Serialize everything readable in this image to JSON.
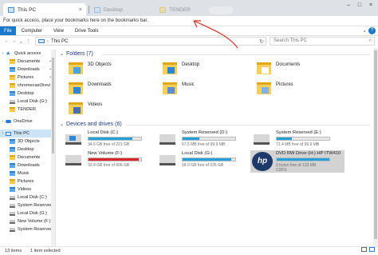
{
  "browser": {
    "tabs": [
      {
        "label": "This PC",
        "close": "×"
      },
      {
        "label": "Desktop"
      },
      {
        "label": "TENDER"
      }
    ],
    "window_controls": [
      "–",
      "□",
      "×"
    ]
  },
  "bookmarks_bar": {
    "hint": "For quick access, place your bookmarks here on the bookmarks bar."
  },
  "ribbon": {
    "tabs": [
      "File",
      "Computer",
      "View",
      "Drive Tools"
    ],
    "help": "?"
  },
  "address": {
    "path": "This PC",
    "search_placeholder": "Search This PC"
  },
  "sidebar": {
    "items": [
      {
        "label": "Quick access",
        "icon": "star-icon",
        "level": 0
      },
      {
        "label": "Documents",
        "icon": "folder-icon",
        "level": 1,
        "pinned": true
      },
      {
        "label": "Downloads",
        "icon": "downloads-icon",
        "level": 1,
        "pinned": true
      },
      {
        "label": "Pictures",
        "icon": "folder-icon",
        "level": 1,
        "pinned": true
      },
      {
        "label": "chromecast3revi",
        "icon": "folder-icon",
        "level": 1
      },
      {
        "label": "Desktop",
        "icon": "folder-blue-icon",
        "level": 1
      },
      {
        "label": "Local Disk (G:)",
        "icon": "drive-icon",
        "level": 1
      },
      {
        "label": "TENDER",
        "icon": "folder-icon",
        "level": 1
      },
      {
        "label": "",
        "icon": "",
        "level": 0
      },
      {
        "label": "OneDrive",
        "icon": "cloud-icon",
        "level": 0
      },
      {
        "label": "",
        "icon": "",
        "level": 0
      },
      {
        "label": "This PC",
        "icon": "pc-icon",
        "level": 0,
        "selected": true
      },
      {
        "label": "3D Objects",
        "icon": "folder-blue-icon",
        "level": 1
      },
      {
        "label": "Desktop",
        "icon": "folder-blue-icon",
        "level": 1
      },
      {
        "label": "Documents",
        "icon": "folder-icon",
        "level": 1
      },
      {
        "label": "Downloads",
        "icon": "downloads-icon",
        "level": 1
      },
      {
        "label": "Music",
        "icon": "music-icon",
        "level": 1
      },
      {
        "label": "Pictures",
        "icon": "folder-icon",
        "level": 1
      },
      {
        "label": "Videos",
        "icon": "videos-icon",
        "level": 1
      },
      {
        "label": "Local Disk (C:)",
        "icon": "drive-icon",
        "level": 1
      },
      {
        "label": "System Reserved",
        "icon": "drive-icon",
        "level": 1
      },
      {
        "label": "Local Disk (G:)",
        "icon": "drive-icon",
        "level": 1
      },
      {
        "label": "New Volume (F:)",
        "icon": "drive-icon",
        "level": 1
      },
      {
        "label": "System Reserved",
        "icon": "drive-icon",
        "level": 1
      }
    ]
  },
  "folders": {
    "header": "Folders (7)",
    "items": [
      {
        "label": "3D Objects",
        "icon": "3d-objects-icon"
      },
      {
        "label": "Desktop",
        "icon": "desktop-folder-icon"
      },
      {
        "label": "Documents",
        "icon": "documents-folder-icon"
      },
      {
        "label": "Downloads",
        "icon": "downloads-folder-icon"
      },
      {
        "label": "Music",
        "icon": "music-folder-icon"
      },
      {
        "label": "Pictures",
        "icon": "pictures-folder-icon"
      },
      {
        "label": "Videos",
        "icon": "videos-folder-icon"
      }
    ]
  },
  "drives": {
    "header": "Devices and drives (6)",
    "items": [
      {
        "name": "Local Disk (C:)",
        "free_text": "34.6 GB free of 221 GB",
        "used_fraction": 0.84,
        "warn": false
      },
      {
        "name": "System Reserved (D:)",
        "free_text": "67.5 MB free of 99.9 MB",
        "used_fraction": 0.32,
        "warn": false
      },
      {
        "name": "System Reserved (E:)",
        "free_text": "71.4 MB free of 99.9 MB",
        "used_fraction": 0.29,
        "warn": false
      },
      {
        "name": "New Volume (F:)",
        "free_text": "33.9 GB free of 906 GB",
        "used_fraction": 0.96,
        "warn": true
      },
      {
        "name": "Local Disk (G:)",
        "free_text": "18.0 GB free of 226 GB",
        "used_fraction": 0.92,
        "warn": false
      },
      {
        "name": "DVD RW Drive (H:) HP ITW410",
        "free_text": "0 bytes free of 133 MB",
        "fs": "CDFS",
        "used_fraction": 1.0,
        "warn": false,
        "selected": true
      }
    ]
  },
  "status_bar": {
    "items_count": "13 items",
    "selected": "1 item selected"
  },
  "colors": {
    "accent": "#1979ca",
    "bar_normal": "#26a0da",
    "bar_warn": "#da2626",
    "annotation": "#d32f2f"
  }
}
